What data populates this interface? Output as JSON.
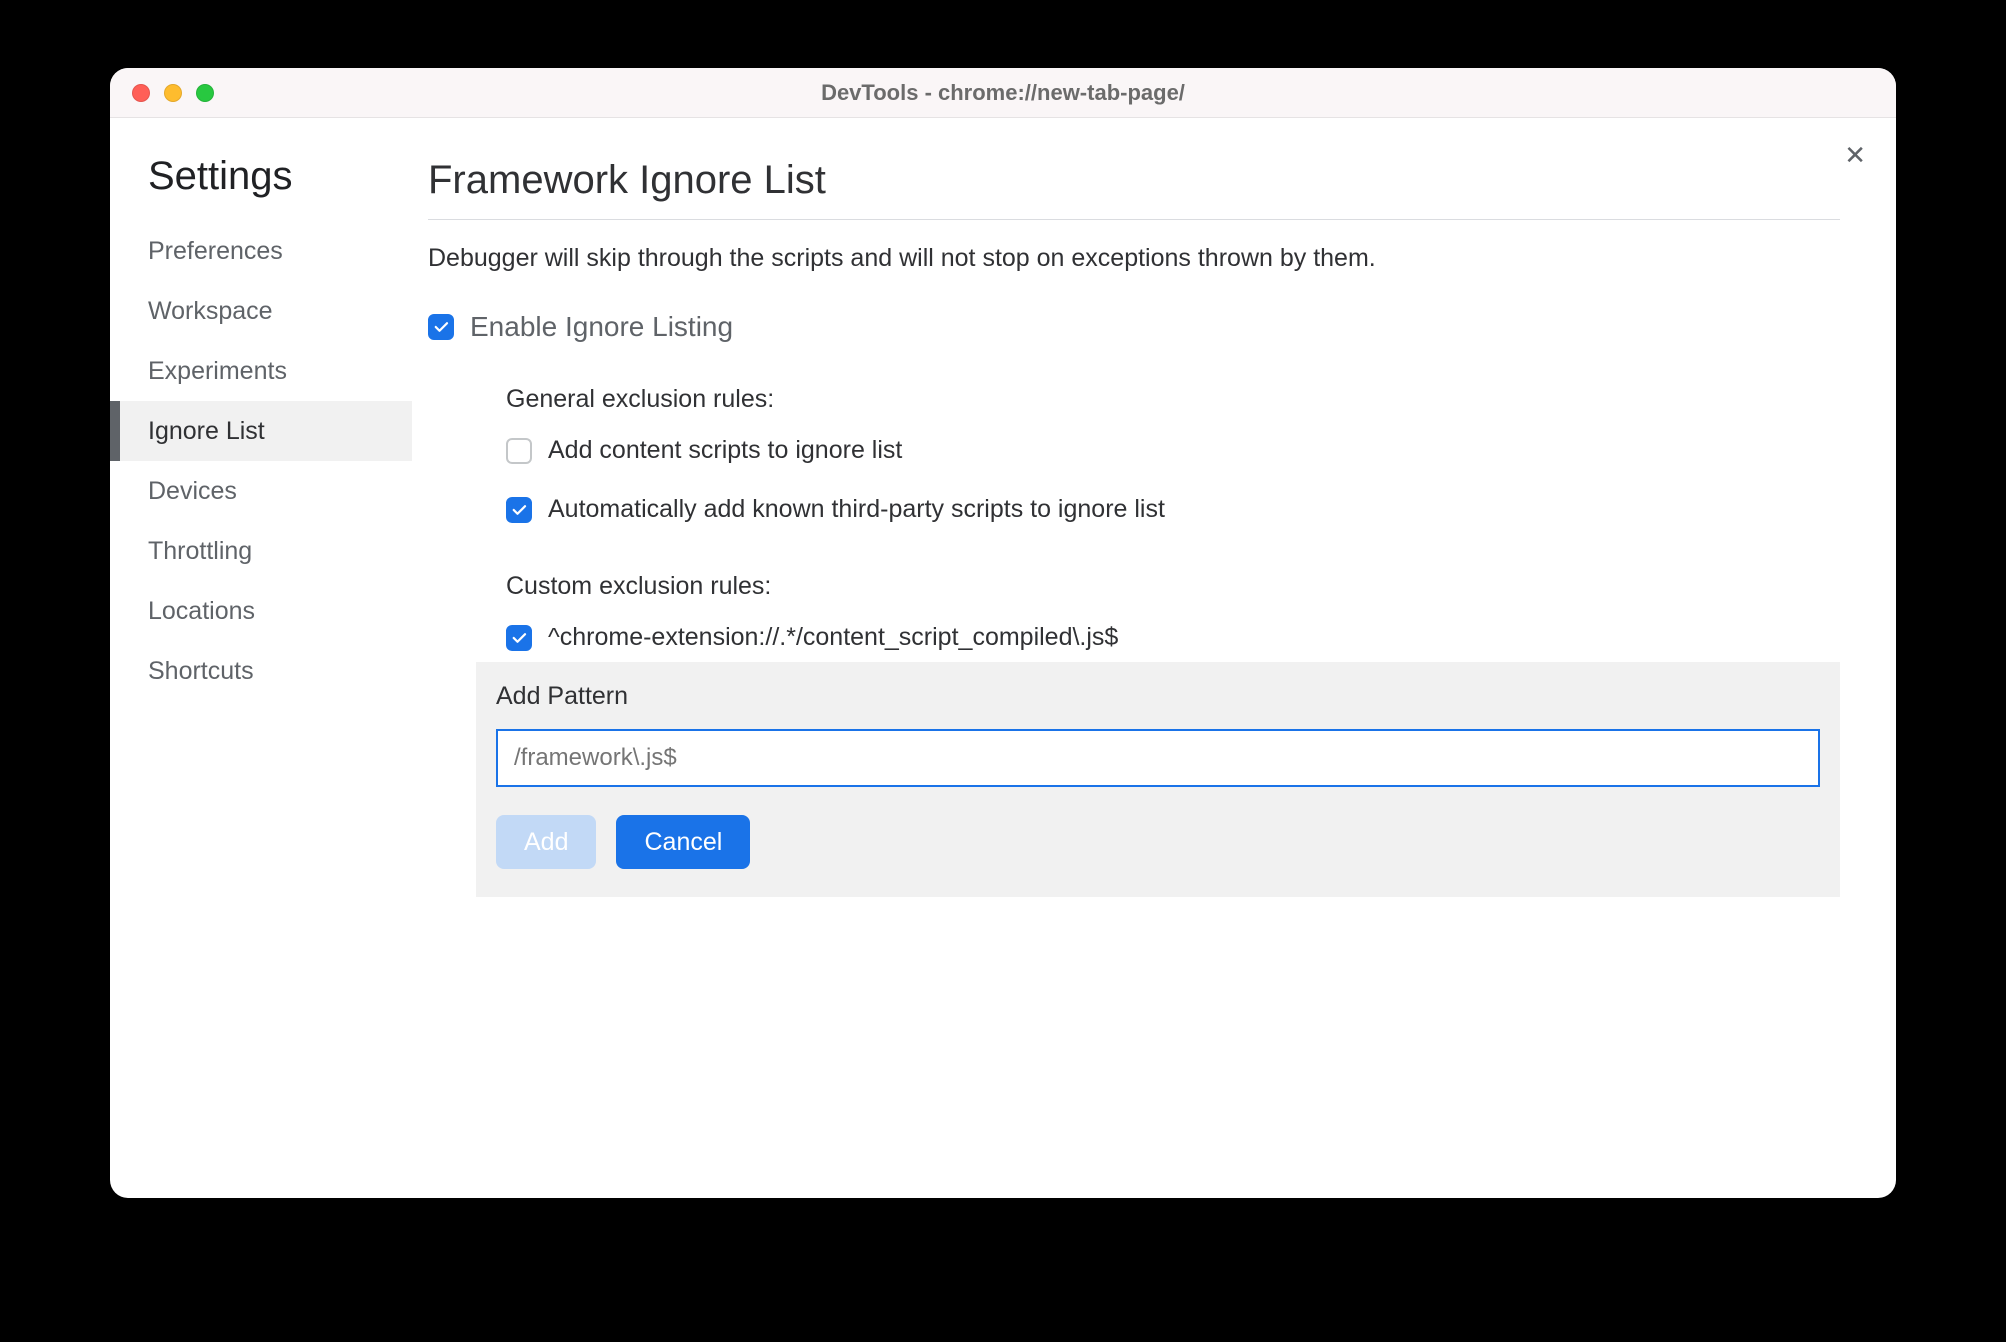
{
  "window": {
    "title": "DevTools - chrome://new-tab-page/"
  },
  "sidebar": {
    "title": "Settings",
    "items": [
      {
        "label": "Preferences",
        "active": false
      },
      {
        "label": "Workspace",
        "active": false
      },
      {
        "label": "Experiments",
        "active": false
      },
      {
        "label": "Ignore List",
        "active": true
      },
      {
        "label": "Devices",
        "active": false
      },
      {
        "label": "Throttling",
        "active": false
      },
      {
        "label": "Locations",
        "active": false
      },
      {
        "label": "Shortcuts",
        "active": false
      }
    ]
  },
  "main": {
    "title": "Framework Ignore List",
    "description": "Debugger will skip through the scripts and will not stop on exceptions thrown by them.",
    "enable_label": "Enable Ignore Listing",
    "enable_checked": true,
    "general_rules_label": "General exclusion rules:",
    "general_rules": [
      {
        "label": "Add content scripts to ignore list",
        "checked": false
      },
      {
        "label": "Automatically add known third-party scripts to ignore list",
        "checked": true
      }
    ],
    "custom_rules_label": "Custom exclusion rules:",
    "custom_rules": [
      {
        "label": "^chrome-extension://.*/content_script_compiled\\.js$",
        "checked": true
      }
    ],
    "add_pattern": {
      "title": "Add Pattern",
      "placeholder": "/framework\\.js$",
      "add_button": "Add",
      "cancel_button": "Cancel"
    }
  },
  "close_label": "✕"
}
